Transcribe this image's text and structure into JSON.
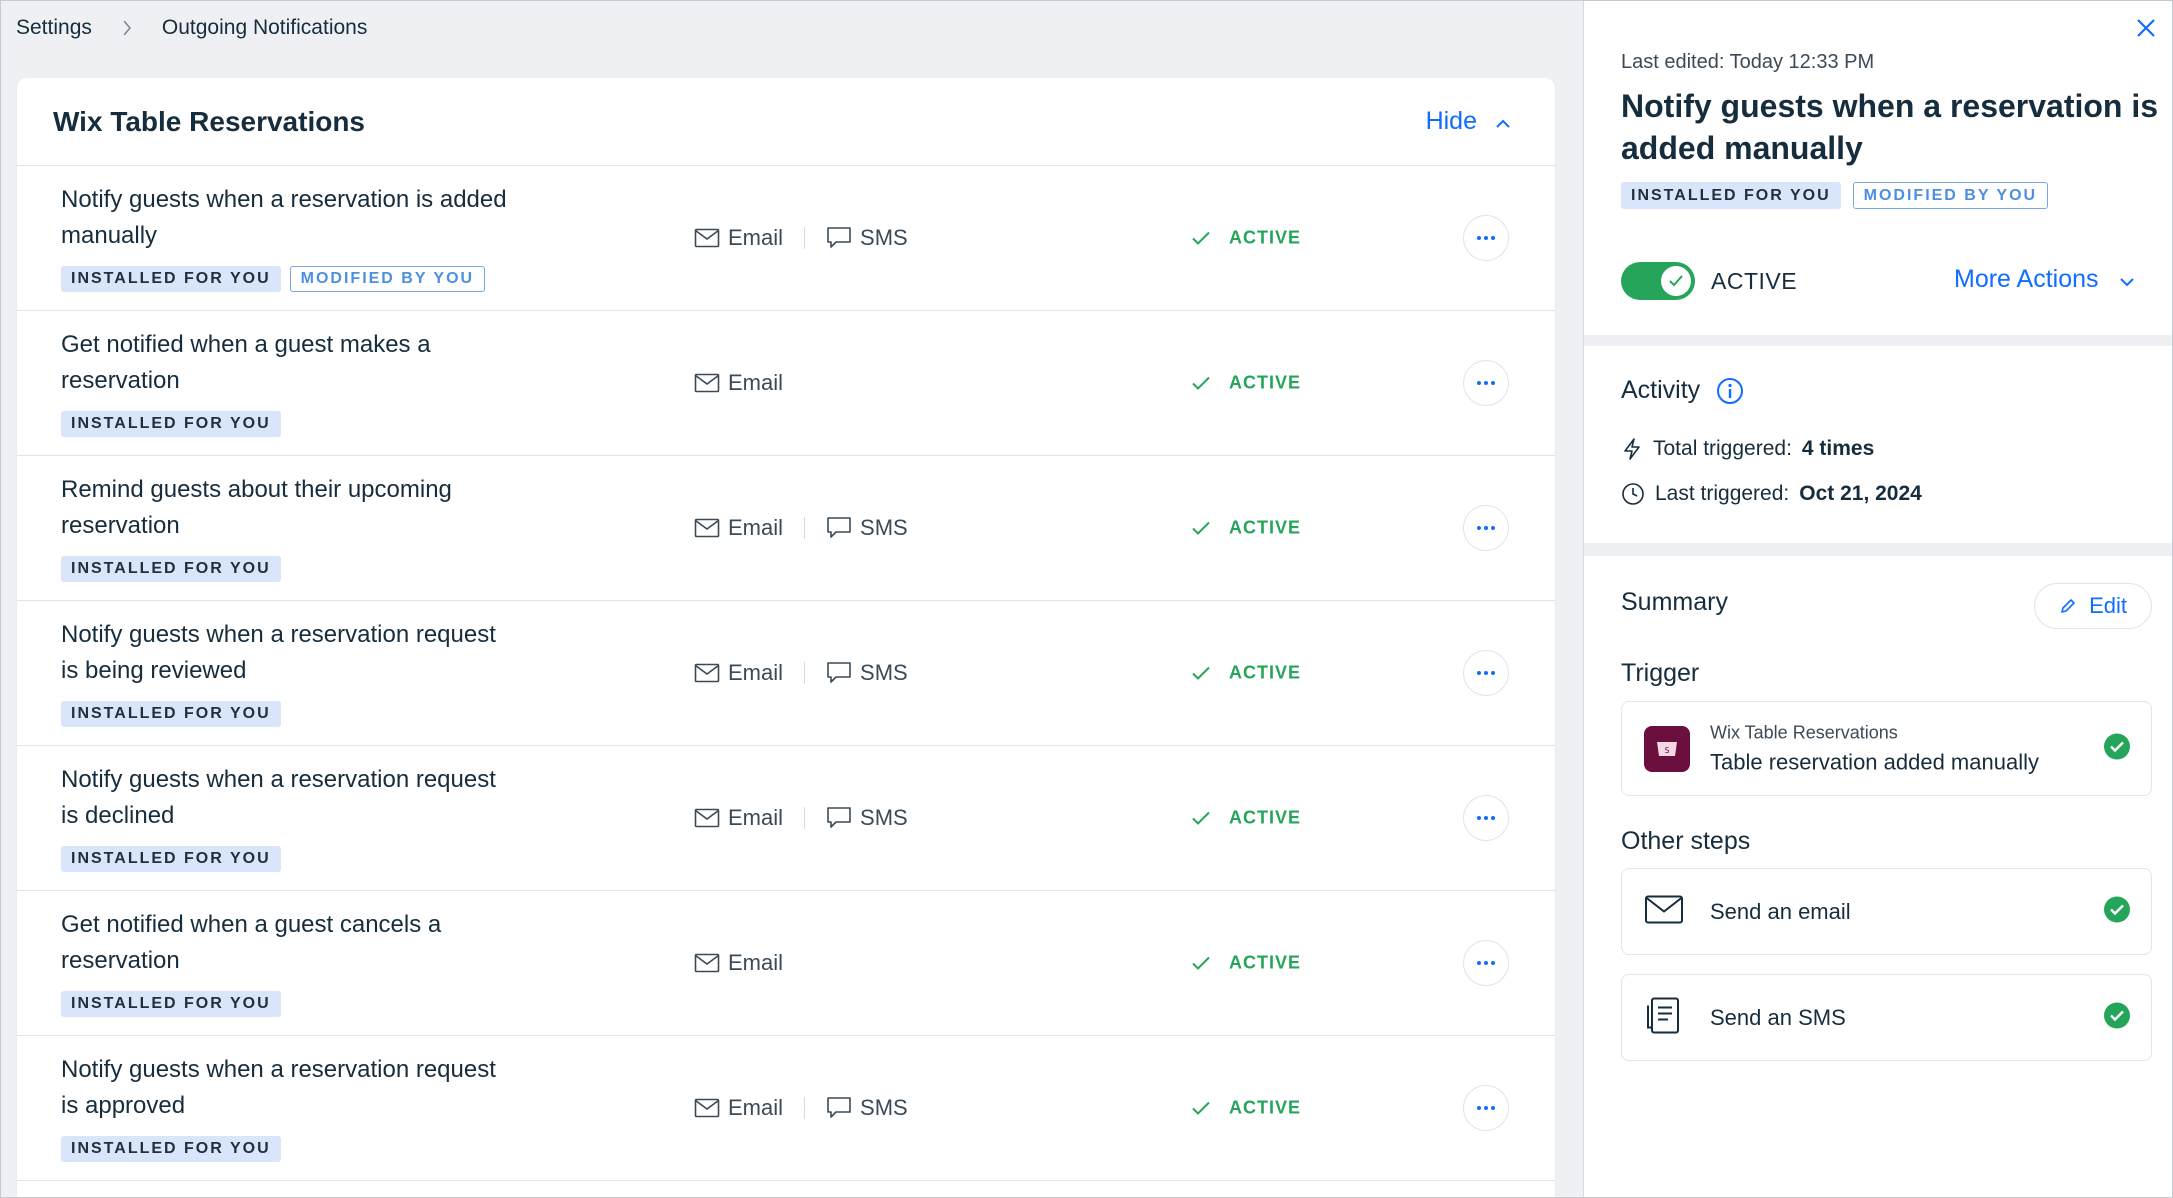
{
  "breadcrumb": {
    "root": "Settings",
    "current": "Outgoing Notifications"
  },
  "card": {
    "title": "Wix Table Reservations",
    "hide_label": "Hide"
  },
  "rows": [
    {
      "title": "Notify guests when a reservation is added manually",
      "badges": [
        "INSTALLED FOR YOU",
        "MODIFIED BY YOU"
      ],
      "channels": [
        "Email",
        "SMS"
      ],
      "status": "ACTIVE"
    },
    {
      "title": "Get notified when a guest makes a reservation",
      "badges": [
        "INSTALLED FOR YOU"
      ],
      "channels": [
        "Email"
      ],
      "status": "ACTIVE"
    },
    {
      "title": "Remind guests about their upcoming reservation",
      "badges": [
        "INSTALLED FOR YOU"
      ],
      "channels": [
        "Email",
        "SMS"
      ],
      "status": "ACTIVE"
    },
    {
      "title": "Notify guests when a reservation request is being reviewed",
      "badges": [
        "INSTALLED FOR YOU"
      ],
      "channels": [
        "Email",
        "SMS"
      ],
      "status": "ACTIVE"
    },
    {
      "title": "Notify guests when a reservation request is declined",
      "badges": [
        "INSTALLED FOR YOU"
      ],
      "channels": [
        "Email",
        "SMS"
      ],
      "status": "ACTIVE"
    },
    {
      "title": "Get notified when a guest cancels a reservation",
      "badges": [
        "INSTALLED FOR YOU"
      ],
      "channels": [
        "Email"
      ],
      "status": "ACTIVE"
    },
    {
      "title": "Notify guests when a reservation request is approved",
      "badges": [
        "INSTALLED FOR YOU"
      ],
      "channels": [
        "Email",
        "SMS"
      ],
      "status": "ACTIVE"
    }
  ],
  "panel": {
    "last_edited": "Last edited: Today 12:33 PM",
    "title": "Notify guests when a reservation is added manually",
    "badges": [
      "INSTALLED FOR YOU",
      "MODIFIED BY YOU"
    ],
    "toggle_label": "ACTIVE",
    "toggle_on": true,
    "more_actions": "More Actions",
    "activity": {
      "heading": "Activity",
      "total_label": "Total triggered:",
      "total_value": "4 times",
      "last_label": "Last triggered:",
      "last_value": "Oct 21, 2024"
    },
    "summary": {
      "heading": "Summary",
      "edit_label": "Edit",
      "trigger_label": "Trigger",
      "trigger_app": "Wix Table Reservations",
      "trigger_event": "Table reservation added manually",
      "other_steps_label": "Other steps",
      "steps": [
        "Send an email",
        "Send an SMS"
      ]
    }
  },
  "colors": {
    "accent": "#116dff",
    "active": "#25a55a",
    "app_icon": "#6b0f3e"
  }
}
